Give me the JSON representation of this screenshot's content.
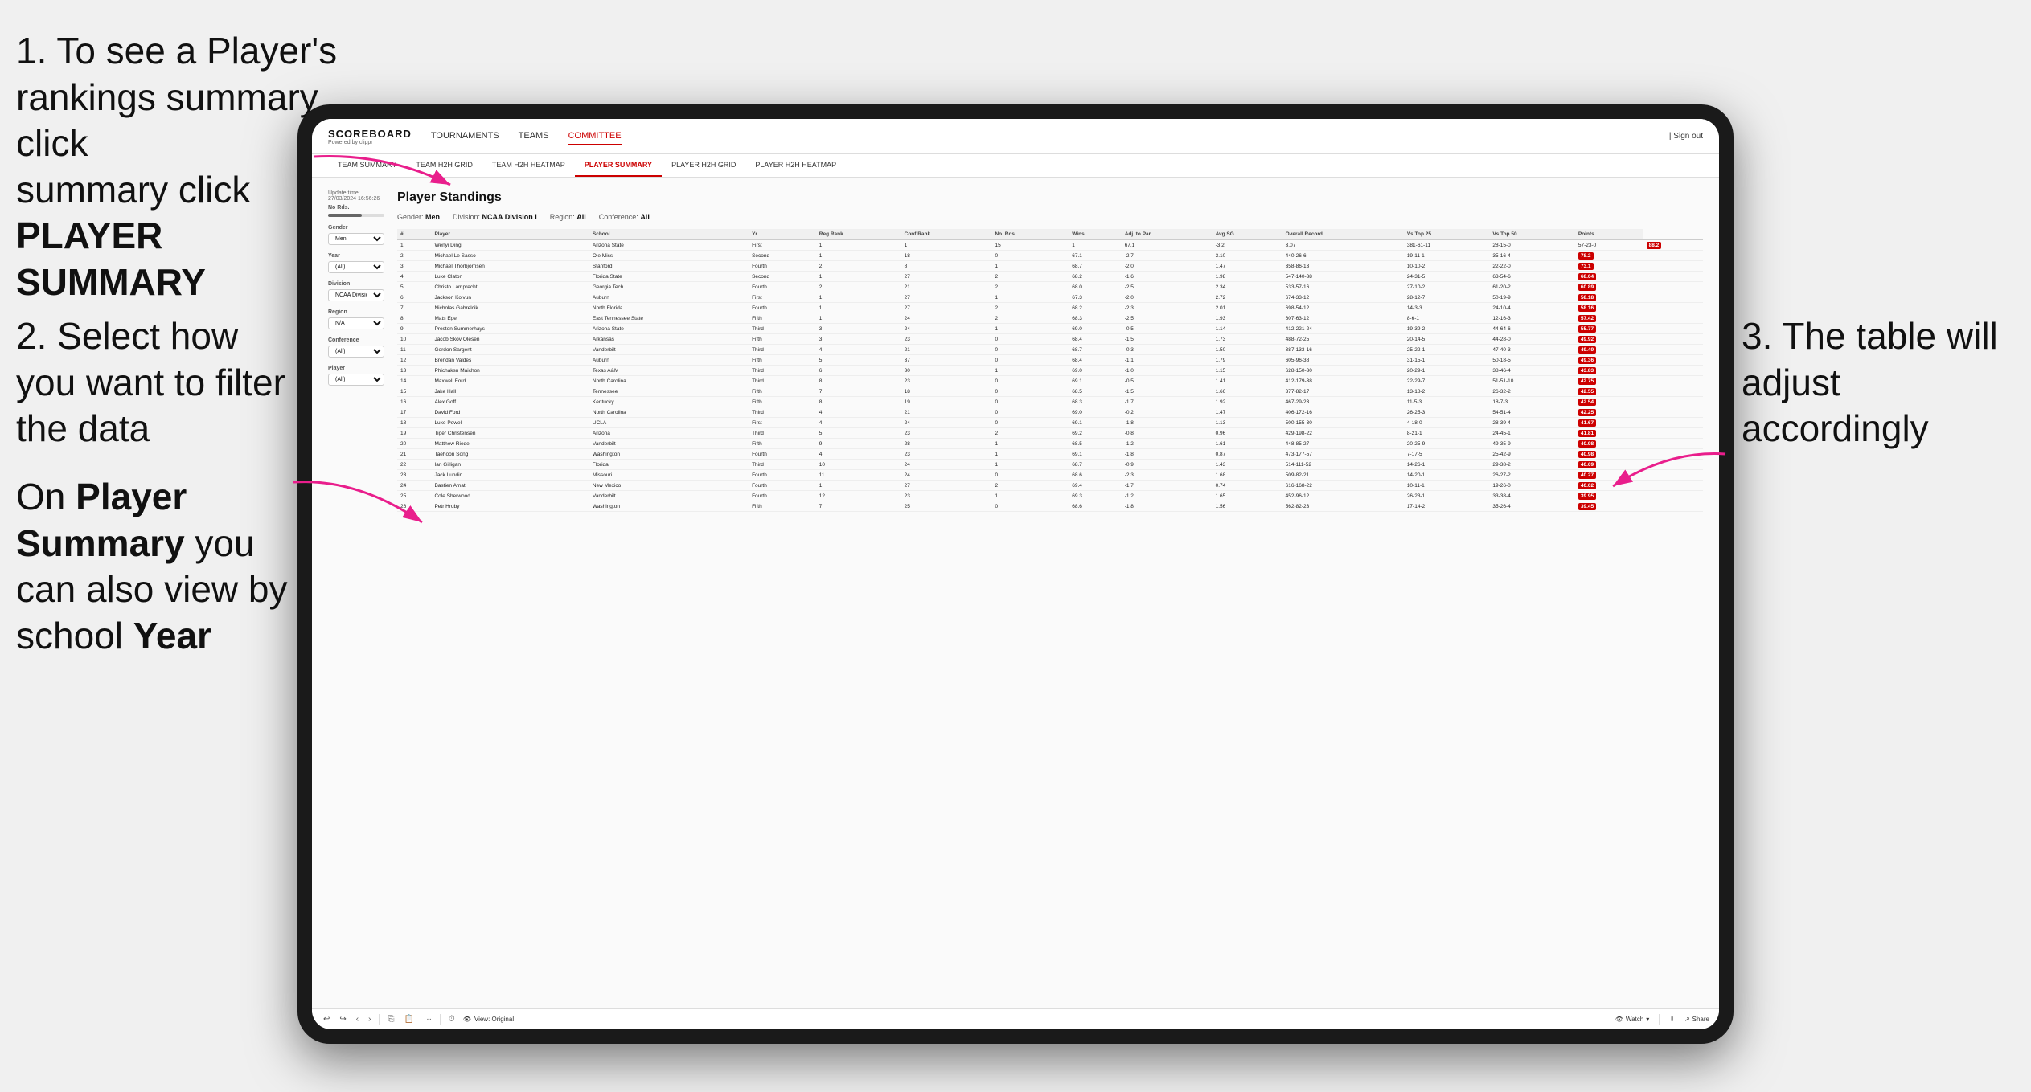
{
  "instructions": {
    "step1": "1. To see a Player's rankings summary click ",
    "step1_bold": "PLAYER SUMMARY",
    "step2_title": "2. Select how you want to filter the data",
    "step3_title": "3. The table will adjust accordingly",
    "step4_title": "On ",
    "step4_bold1": "Player Summary",
    "step4_mid": " you can also view by school ",
    "step4_bold2": "Year"
  },
  "nav": {
    "logo": "SCOREBOARD",
    "logo_sub": "Powered by clippr",
    "items": [
      "TOURNAMENTS",
      "TEAMS",
      "COMMITTEE"
    ],
    "right": [
      "| Sign out"
    ]
  },
  "subnav": {
    "items": [
      "TEAM SUMMARY",
      "TEAM H2H GRID",
      "TEAM H2H HEATMAP",
      "PLAYER SUMMARY",
      "PLAYER H2H GRID",
      "PLAYER H2H HEATMAP"
    ],
    "active": "PLAYER SUMMARY"
  },
  "main": {
    "update_time": "Update time: 27/03/2024 16:56:26",
    "title": "Player Standings",
    "filters": {
      "gender_label": "Gender:",
      "gender_val": "Men",
      "division_label": "Division:",
      "division_val": "NCAA Division I",
      "region_label": "Region:",
      "region_val": "All",
      "conference_label": "Conference:",
      "conference_val": "All"
    },
    "left_filters": {
      "no_rds_label": "No Rds.",
      "gender_label": "Gender",
      "gender_val": "Men",
      "year_label": "Year",
      "year_val": "(All)",
      "division_label": "Division",
      "division_val": "NCAA Division I",
      "region_label": "Region",
      "region_val": "N/A",
      "conference_label": "Conference",
      "conference_val": "(All)",
      "player_label": "Player",
      "player_val": "(All)"
    }
  },
  "table": {
    "headers": [
      "#",
      "Player",
      "School",
      "Yr",
      "Reg Rank",
      "Conf Rank",
      "No. Rds.",
      "Wins",
      "Adj. to Par",
      "Avg SG",
      "Overall Record",
      "Vs Top 25",
      "Vs Top 50",
      "Points"
    ],
    "rows": [
      [
        "1",
        "Wenyi Ding",
        "Arizona State",
        "First",
        "1",
        "1",
        "15",
        "1",
        "67.1",
        "-3.2",
        "3.07",
        "381-61-11",
        "28-15-0",
        "57-23-0",
        "88.2"
      ],
      [
        "2",
        "Michael Le Sasso",
        "Ole Miss",
        "Second",
        "1",
        "18",
        "0",
        "67.1",
        "-2.7",
        "3.10",
        "440-26-6",
        "19-11-1",
        "35-16-4",
        "78.2"
      ],
      [
        "3",
        "Michael Thorbjornsen",
        "Stanford",
        "Fourth",
        "2",
        "8",
        "1",
        "68.7",
        "-2.0",
        "1.47",
        "358-86-13",
        "10-10-2",
        "22-22-0",
        "73.1"
      ],
      [
        "4",
        "Luke Claton",
        "Florida State",
        "Second",
        "1",
        "27",
        "2",
        "68.2",
        "-1.6",
        "1.98",
        "547-140-38",
        "24-31-5",
        "63-54-6",
        "68.04"
      ],
      [
        "5",
        "Christo Lamprecht",
        "Georgia Tech",
        "Fourth",
        "2",
        "21",
        "2",
        "68.0",
        "-2.5",
        "2.34",
        "533-57-16",
        "27-10-2",
        "61-20-2",
        "60.89"
      ],
      [
        "6",
        "Jackson Koivun",
        "Auburn",
        "First",
        "1",
        "27",
        "1",
        "67.3",
        "-2.0",
        "2.72",
        "674-33-12",
        "28-12-7",
        "50-19-9",
        "58.18"
      ],
      [
        "7",
        "Nicholas Gabrelcik",
        "North Florida",
        "Fourth",
        "1",
        "27",
        "2",
        "68.2",
        "-2.3",
        "2.01",
        "698-54-12",
        "14-3-3",
        "24-10-4",
        "58.16"
      ],
      [
        "8",
        "Mats Ege",
        "East Tennessee State",
        "Fifth",
        "1",
        "24",
        "2",
        "68.3",
        "-2.5",
        "1.93",
        "607-63-12",
        "8-6-1",
        "12-16-3",
        "57.42"
      ],
      [
        "9",
        "Preston Summerhays",
        "Arizona State",
        "Third",
        "3",
        "24",
        "1",
        "69.0",
        "-0.5",
        "1.14",
        "412-221-24",
        "19-39-2",
        "44-64-6",
        "55.77"
      ],
      [
        "10",
        "Jacob Skov Olesen",
        "Arkansas",
        "Fifth",
        "3",
        "23",
        "0",
        "68.4",
        "-1.5",
        "1.73",
        "488-72-25",
        "20-14-5",
        "44-28-0",
        "49.92"
      ],
      [
        "11",
        "Gordon Sargent",
        "Vanderbilt",
        "Third",
        "4",
        "21",
        "0",
        "68.7",
        "-0.3",
        "1.50",
        "387-133-16",
        "25-22-1",
        "47-40-3",
        "49.49"
      ],
      [
        "12",
        "Brendan Valdes",
        "Auburn",
        "Fifth",
        "5",
        "37",
        "0",
        "68.4",
        "-1.1",
        "1.79",
        "605-96-38",
        "31-15-1",
        "50-18-5",
        "49.36"
      ],
      [
        "13",
        "Phichaksn Maichon",
        "Texas A&M",
        "Third",
        "6",
        "30",
        "1",
        "69.0",
        "-1.0",
        "1.15",
        "628-150-30",
        "20-29-1",
        "38-46-4",
        "43.83"
      ],
      [
        "14",
        "Maxwell Ford",
        "North Carolina",
        "Third",
        "8",
        "23",
        "0",
        "69.1",
        "-0.5",
        "1.41",
        "412-179-38",
        "22-29-7",
        "51-51-10",
        "42.75"
      ],
      [
        "15",
        "Jake Hall",
        "Tennessee",
        "Fifth",
        "7",
        "18",
        "0",
        "68.5",
        "-1.5",
        "1.66",
        "377-82-17",
        "13-18-2",
        "26-32-2",
        "42.55"
      ],
      [
        "16",
        "Alex Goff",
        "Kentucky",
        "Fifth",
        "8",
        "19",
        "0",
        "68.3",
        "-1.7",
        "1.92",
        "467-29-23",
        "11-5-3",
        "18-7-3",
        "42.54"
      ],
      [
        "17",
        "David Ford",
        "North Carolina",
        "Third",
        "4",
        "21",
        "0",
        "69.0",
        "-0.2",
        "1.47",
        "406-172-16",
        "26-25-3",
        "54-51-4",
        "42.25"
      ],
      [
        "18",
        "Luke Powell",
        "UCLA",
        "First",
        "4",
        "24",
        "0",
        "69.1",
        "-1.8",
        "1.13",
        "500-155-30",
        "4-18-0",
        "28-39-4",
        "41.67"
      ],
      [
        "19",
        "Tiger Christensen",
        "Arizona",
        "Third",
        "5",
        "23",
        "2",
        "69.2",
        "-0.8",
        "0.96",
        "429-198-22",
        "8-21-1",
        "24-45-1",
        "41.81"
      ],
      [
        "20",
        "Matthew Riedel",
        "Vanderbilt",
        "Fifth",
        "9",
        "28",
        "1",
        "68.5",
        "-1.2",
        "1.61",
        "448-85-27",
        "20-25-9",
        "49-35-9",
        "40.98"
      ],
      [
        "21",
        "Taehoon Song",
        "Washington",
        "Fourth",
        "4",
        "23",
        "1",
        "69.1",
        "-1.8",
        "0.87",
        "473-177-57",
        "7-17-5",
        "25-42-9",
        "40.98"
      ],
      [
        "22",
        "Ian Gilligan",
        "Florida",
        "Third",
        "10",
        "24",
        "1",
        "68.7",
        "-0.9",
        "1.43",
        "514-111-52",
        "14-26-1",
        "29-38-2",
        "40.69"
      ],
      [
        "23",
        "Jack Lundin",
        "Missouri",
        "Fourth",
        "11",
        "24",
        "0",
        "68.6",
        "-2.3",
        "1.68",
        "509-82-21",
        "14-20-1",
        "26-27-2",
        "40.27"
      ],
      [
        "24",
        "Bastien Amat",
        "New Mexico",
        "Fourth",
        "1",
        "27",
        "2",
        "69.4",
        "-1.7",
        "0.74",
        "616-168-22",
        "10-11-1",
        "19-26-0",
        "40.02"
      ],
      [
        "25",
        "Cole Sherwood",
        "Vanderbilt",
        "Fourth",
        "12",
        "23",
        "1",
        "69.3",
        "-1.2",
        "1.65",
        "452-96-12",
        "26-23-1",
        "33-38-4",
        "39.95"
      ],
      [
        "26",
        "Petr Hruby",
        "Washington",
        "Fifth",
        "7",
        "25",
        "0",
        "68.6",
        "-1.8",
        "1.56",
        "562-82-23",
        "17-14-2",
        "35-26-4",
        "39.45"
      ]
    ]
  },
  "toolbar": {
    "view_label": "View: Original",
    "watch_label": "Watch",
    "share_label": "Share"
  },
  "colors": {
    "accent": "#cc0000",
    "nav_active": "#cc0000"
  }
}
